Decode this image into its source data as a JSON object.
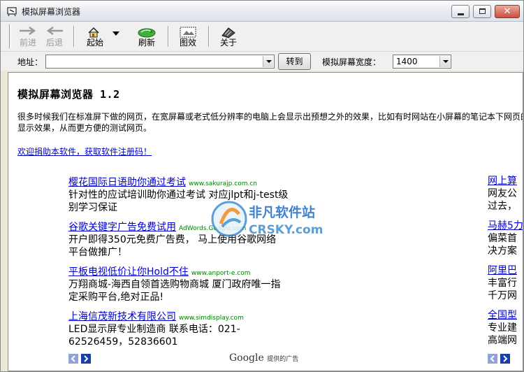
{
  "window": {
    "title": "模拟屏幕浏览器"
  },
  "toolbar": {
    "forward_label": "前进",
    "back_label": "后退",
    "home_label": "起始",
    "refresh_label": "刷新",
    "image_label": "图效",
    "about_label": "关于"
  },
  "addressbar": {
    "label": "地址：",
    "value": "",
    "go_label": "转到",
    "width_label": "模拟屏幕宽度：",
    "width_value": "1400"
  },
  "page": {
    "heading": "模拟屏幕浏览器 1.2",
    "description": "很多时候我们在标准屏下做的网页，在宽屏幕或老式低分辨率的电脑上会显示出预想之外的效果，比如有时网站在小屏幕的笔记本下网页的显示效果，从而更方便的测试网页。",
    "donate_link": "欢迎捐助本软件，获取软件注册码！"
  },
  "ads": [
    {
      "title": "樱花国际日语助你通过考试",
      "url": "www.sakurajp.com.cn",
      "desc_line1": "针对性的应试培训助你通过考试  对应jlpt和j-test级",
      "desc_line2": "别学习保证"
    },
    {
      "title": "谷歌关键字广告免费试用",
      "url": "AdWords.Google.com",
      "desc_line1": "开户即得350元免费广告费，   马上使用谷歌网络",
      "desc_line2": "平台做推广！"
    },
    {
      "title": "平板电视低价让你Hold不住",
      "url": "www.anport-e.com",
      "desc_line1": "万翔商城-海西自领首选购物商城  厦门政府唯一指",
      "desc_line2": "定采购平台,绝对正品!"
    },
    {
      "title": "上海信茂新技术有限公司",
      "url": "www.simdisplay.com",
      "desc_line1": "LED显示屏专业制造商  联系电话：021-",
      "desc_line2": "62526459，52836601"
    }
  ],
  "ads_right": [
    {
      "title": "网上算",
      "line1": "网友公",
      "line2": "过去，"
    },
    {
      "title": "马赫5力",
      "line1": "偏菜首",
      "line2": "决方案"
    },
    {
      "title": "阿里巴",
      "line1": "丰富行",
      "line2": "千万网"
    },
    {
      "title": "全国型",
      "line1": "专业建",
      "line2": "高端网"
    }
  ],
  "footer": {
    "google": "Google",
    "provided": "提供的广告"
  },
  "watermark": {
    "line1": "非凡软件站",
    "line2": "CRSKY.com"
  }
}
